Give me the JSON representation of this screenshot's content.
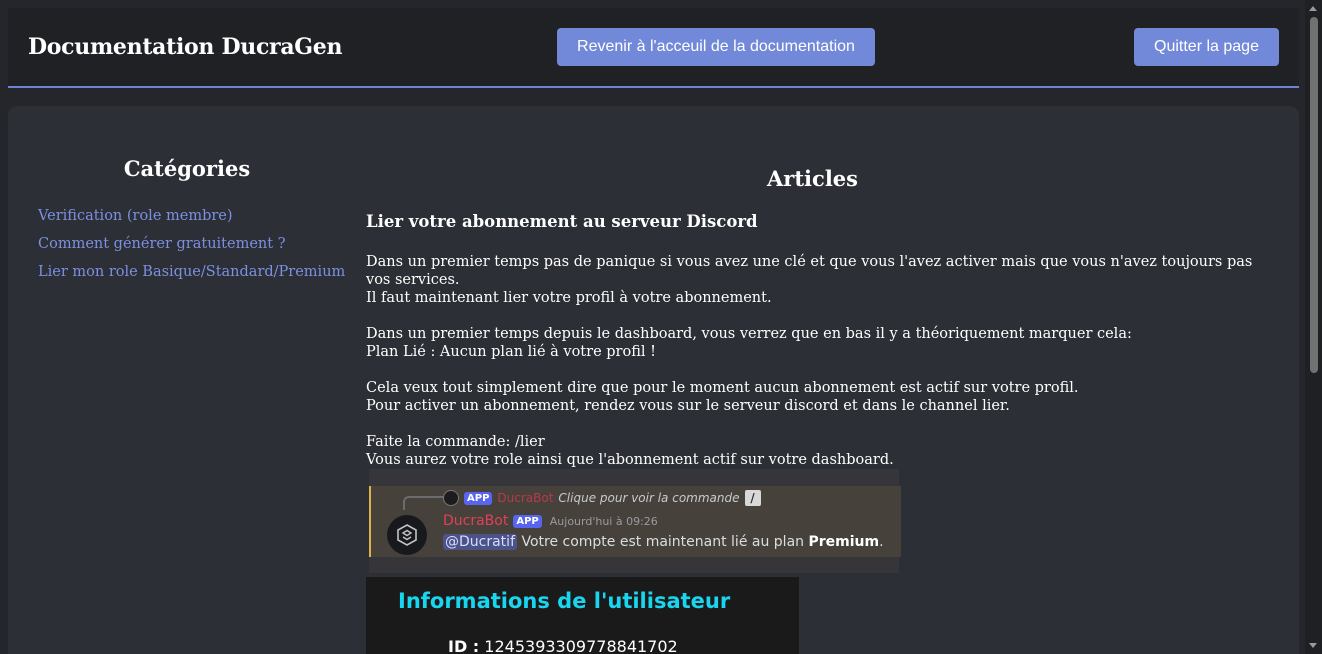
{
  "header": {
    "title": "Documentation DucraGen",
    "home_button": "Revenir à l'acceuil de la documentation",
    "quit_button": "Quitter la page"
  },
  "sidebar": {
    "title": "Catégories",
    "items": [
      {
        "label": "Verification (role membre)"
      },
      {
        "label": "Comment générer gratuitement ?"
      },
      {
        "label": "Lier mon role Basique/Standard/Premium"
      }
    ]
  },
  "main": {
    "title": "Articles",
    "article": {
      "heading": "Lier votre abonnement au serveur Discord",
      "p1_line1": "Dans un premier temps pas de panique si vous avez une clé et que vous l'avez activer mais que vous n'avez toujours pas vos services.",
      "p1_line2": "Il faut maintenant lier votre profil à votre abonnement.",
      "p2_line1": "Dans un premier temps depuis le dashboard, vous verrez que en bas il y a théoriquement marquer cela:",
      "p2_line2": "Plan Lié : Aucun plan lié à votre profil !",
      "p3_line1": "Cela veux tout simplement dire que pour le moment aucun abonnement est actif sur votre profil.",
      "p3_line2": "Pour activer un abonnement, rendez vous sur le serveur discord et dans le channel lier.",
      "p4_line1": "Faite la commande: /lier",
      "p4_line2": "Vous aurez votre role ainsi que l'abonnement actif sur votre dashboard."
    }
  },
  "discord_screenshot": {
    "app_badge": "APP",
    "reply_bot_name": "DucraBot",
    "reply_text": "Clique pour voir la commande",
    "bot_name": "DucraBot",
    "timestamp": "Aujourd'hui à 09:26",
    "mention": "@Ducratif",
    "message": "Votre compte est maintenant lié au plan",
    "plan": "Premium",
    "period": "."
  },
  "user_info": {
    "title": "Informations de l'utilisateur",
    "id_label": "ID :",
    "id_value": "1245393309778841702"
  },
  "colors": {
    "accent": "#7289da",
    "background": "#24262b",
    "panel": "#2c2f35",
    "link": "#7d90e0",
    "cyan_title": "#19d6f0"
  }
}
